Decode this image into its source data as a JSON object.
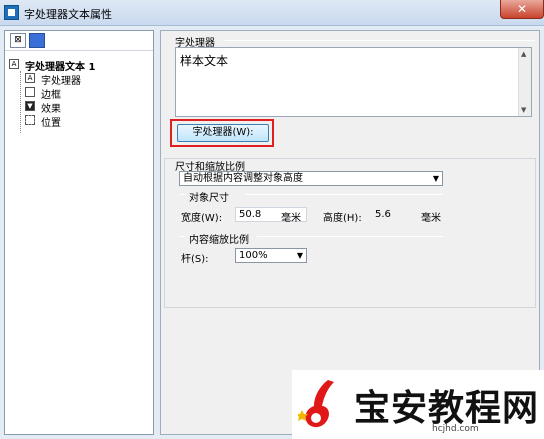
{
  "window": {
    "title": "字处理器文本属性",
    "close_icon": "close-icon"
  },
  "toolbar": {
    "btn1_icon": "expand-icon",
    "btn2_icon": "layers-icon"
  },
  "tree": {
    "root": "字处理器文本 1",
    "items": [
      {
        "label": "字处理器",
        "icon": "text-icon"
      },
      {
        "label": "边框",
        "icon": "border-icon"
      },
      {
        "label": "效果",
        "icon": "effect-icon"
      },
      {
        "label": "位置",
        "icon": "position-icon"
      }
    ]
  },
  "word_processor": {
    "group_label": "字处理器",
    "text_value": "样本文本",
    "button_label": "字处理器(W):"
  },
  "size_scale": {
    "group_label": "尺寸和缩放比例",
    "mode_selected": "自动根据内容调整对象高度",
    "object_size_label": "对象尺寸",
    "width_label": "宽度(W):",
    "width_value": "50.8",
    "width_unit": "毫米",
    "height_label": "高度(H):",
    "height_value": "5.6",
    "height_unit": "毫米",
    "content_scale_label": "内容缩放比例",
    "scale_label": "杆(S):",
    "scale_value": "100%"
  },
  "watermark": {
    "text": "宝安教程网",
    "url": "hcjhd.com"
  },
  "colors": {
    "highlight": "#e02020",
    "button_border": "#3c7fb1",
    "titlebar": "#c9d9ee"
  }
}
